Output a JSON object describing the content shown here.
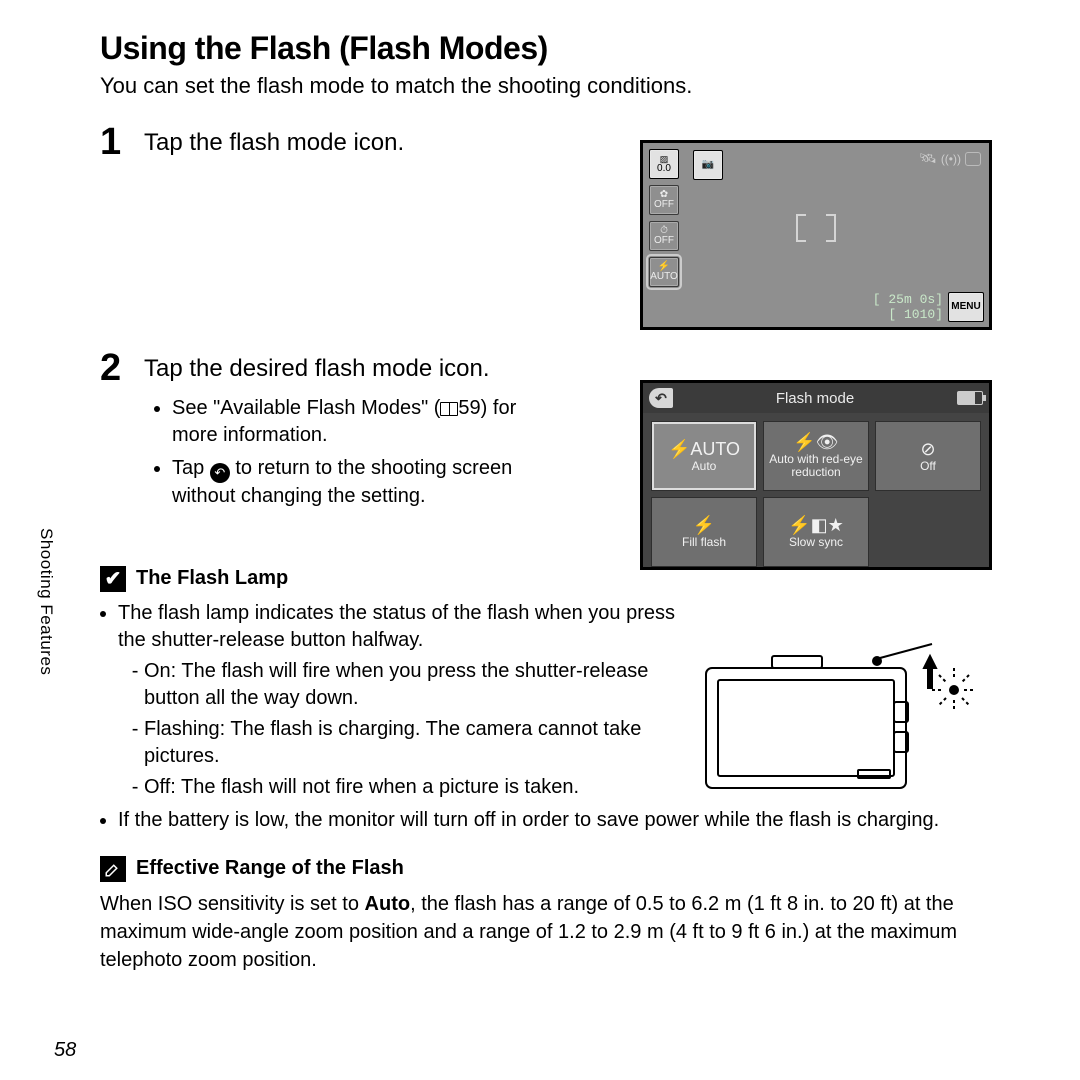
{
  "title": "Using the Flash (Flash Modes)",
  "subtitle": "You can set the flash mode to match the shooting conditions.",
  "side_tab": "Shooting Features",
  "page_number": "58",
  "steps": {
    "s1": {
      "num": "1",
      "head": "Tap the flash mode icon."
    },
    "s2": {
      "num": "2",
      "head": "Tap the desired flash mode icon.",
      "b1a": "See \"Available Flash Modes\" (",
      "b1b": "59) for more information.",
      "b2a": "Tap ",
      "b2b": " to return to the shooting screen without changing the setting."
    }
  },
  "screen1": {
    "icon_ev": "0.0",
    "icon_off1": "OFF",
    "icon_off2": "OFF",
    "icon_auto": "AUTO",
    "time": "[  25m 0s]",
    "shots": "[ 1010]",
    "menu": "MENU"
  },
  "screen2": {
    "title": "Flash mode",
    "back": "↶",
    "opts": {
      "auto_icon": "⚡AUTO",
      "auto_label": "Auto",
      "redeye_icon": "⚡👁",
      "redeye_label": "Auto with red-eye reduction",
      "off_icon": "⊘",
      "off_label": "Off",
      "fill_icon": "⚡",
      "fill_label": "Fill flash",
      "slow_icon": "⚡◧★",
      "slow_label": "Slow sync"
    }
  },
  "note1": {
    "icon": "✔",
    "title": "The Flash Lamp",
    "l1": "The flash lamp indicates the status of the flash when you press the shutter-release button halfway.",
    "s1": "On: The flash will fire when you press the shutter-release button all the way down.",
    "s2": "Flashing: The flash is charging. The camera cannot take pictures.",
    "s3": "Off: The flash will not fire when a picture is taken.",
    "l2": "If the battery is low, the monitor will turn off in order to save power while the flash is charging."
  },
  "note2": {
    "title": "Effective Range of the Flash",
    "p1a": "When ISO sensitivity is set to ",
    "p1b": "Auto",
    "p1c": ", the flash has a range of 0.5 to 6.2 m (1 ft 8 in. to 20 ft) at the maximum wide-angle zoom position and a range of 1.2 to 2.9 m (4 ft to 9 ft 6 in.) at the maximum telephoto zoom position."
  }
}
